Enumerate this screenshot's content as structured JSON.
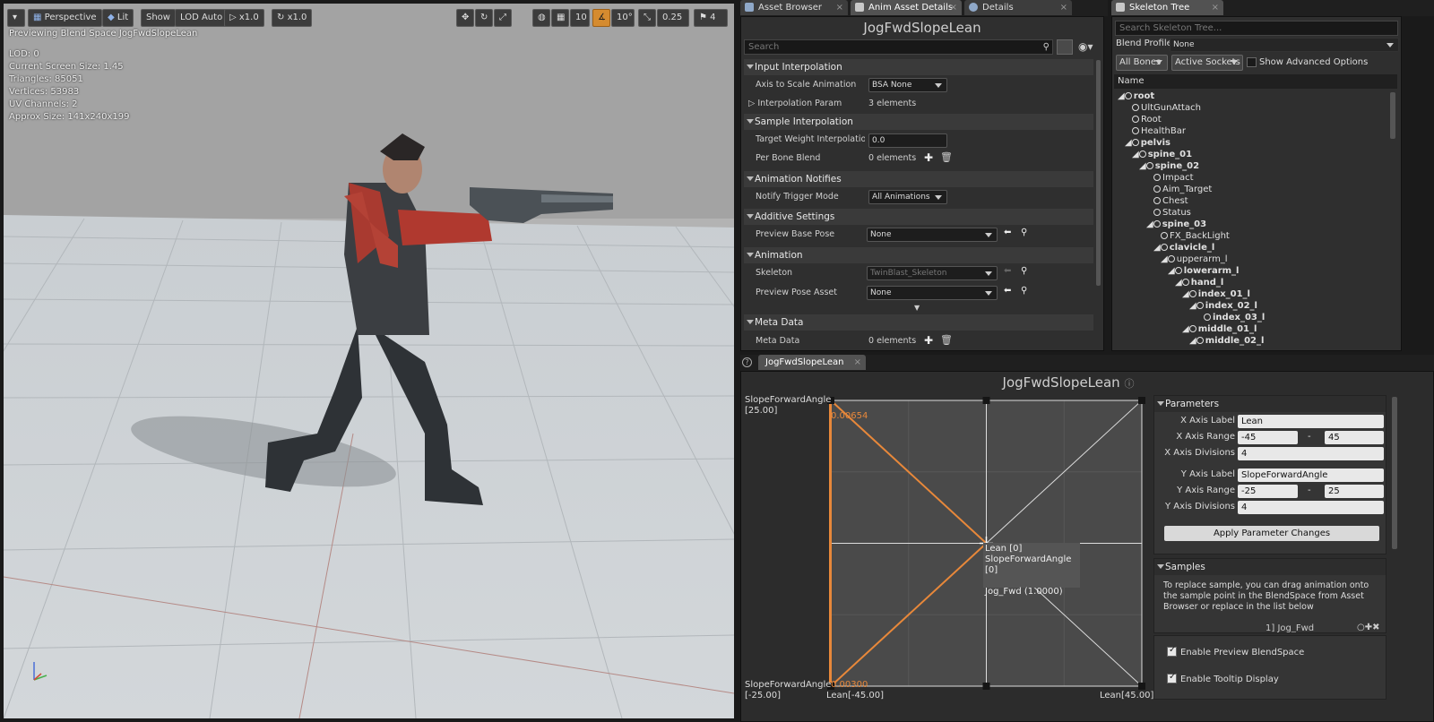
{
  "viewport": {
    "toolbar": {
      "perspective": "Perspective",
      "lit": "Lit",
      "show": "Show",
      "lod": "LOD Auto",
      "speed1": "x1.0",
      "speed2": "x1.0",
      "grid_snap": "10",
      "rot_snap": "10°",
      "scale_snap": "0.25",
      "camera_speed": "4"
    },
    "preview_text": "Previewing Blend Space JogFwdSlopeLean",
    "stats": [
      "LOD: 0",
      "Current Screen Size: 1.45",
      "Triangles: 85051",
      "Vertices: 53983",
      "UV Channels: 2",
      "Approx Size: 141x240x199"
    ]
  },
  "details_panel": {
    "tabs": [
      "Asset Browser",
      "Anim Asset Details",
      "Details"
    ],
    "title": "JogFwdSlopeLean",
    "search_placeholder": "Search",
    "categories": [
      {
        "name": "Input Interpolation",
        "props": [
          {
            "label": "Axis to Scale Animation",
            "value": "BSA None"
          },
          {
            "label": "Interpolation Param",
            "value": "3 elements"
          }
        ]
      },
      {
        "name": "Sample Interpolation",
        "props": [
          {
            "label": "Target Weight Interpolation Sp",
            "value": "0.0"
          },
          {
            "label": "Per Bone Blend",
            "value": "0 elements"
          }
        ]
      },
      {
        "name": "Animation Notifies",
        "props": [
          {
            "label": "Notify Trigger Mode",
            "value": "All Animations"
          }
        ]
      },
      {
        "name": "Additive Settings",
        "props": [
          {
            "label": "Preview Base Pose",
            "value": "None"
          }
        ]
      },
      {
        "name": "Animation",
        "props": [
          {
            "label": "Skeleton",
            "value": "TwinBlast_Skeleton"
          },
          {
            "label": "Preview Pose Asset",
            "value": "None"
          }
        ]
      },
      {
        "name": "Meta Data",
        "props": [
          {
            "label": "Meta Data",
            "value": "0 elements"
          }
        ]
      }
    ]
  },
  "skeleton_tree": {
    "tab": "Skeleton Tree",
    "search_placeholder": "Search Skeleton Tree...",
    "blend_profile_label": "Blend Profile:",
    "blend_profile_value": "None",
    "all_bones": "All Bones",
    "active_sockets": "Active Sockets",
    "show_advanced": "Show Advanced Options",
    "column": "Name",
    "items": [
      "root",
      "UltGunAttach",
      "Root",
      "HealthBar",
      "pelvis",
      "spine_01",
      "spine_02",
      "Impact",
      "Aim_Target",
      "Chest",
      "Status",
      "spine_03",
      "FX_BackLight",
      "clavicle_l",
      "upperarm_l",
      "lowerarm_l",
      "hand_l",
      "index_01_l",
      "index_02_l",
      "index_03_l",
      "middle_01_l",
      "middle_02_l"
    ]
  },
  "blendspace": {
    "tab": "JogFwdSlopeLean",
    "title": "JogFwdSlopeLean",
    "y_axis_top": "SlopeForwardAngle",
    "y_max_label": "[25.00]",
    "y_axis_bottom": "SlopeForwardAngle",
    "y_min_label": "[-25.00]",
    "x_min_label": "Lean[-45.00]",
    "x_max_label": "Lean[45.00]",
    "weight_top": "0.00654",
    "weight_bottom": "0.00300",
    "tooltip": {
      "line1": "Lean [0]",
      "line2": "SlopeForwardAngle [0]",
      "line3": "Jog_Fwd (1.0000)"
    }
  },
  "parameters": {
    "header": "Parameters",
    "x_axis_label_label": "X Axis Label",
    "x_axis_label_value": "Lean",
    "x_range_label": "X Axis Range",
    "x_range_min": "-45",
    "x_range_max": "45",
    "x_divisions_label": "X Axis Divisions",
    "x_divisions": "4",
    "y_axis_label_label": "Y Axis Label",
    "y_axis_label_value": "SlopeForwardAngle",
    "y_range_label": "Y Axis Range",
    "y_range_min": "-25",
    "y_range_max": "25",
    "y_divisions_label": "Y Axis Divisions",
    "y_divisions": "4",
    "range_sep": "-",
    "apply_button": "Apply Parameter Changes"
  },
  "samples": {
    "header": "Samples",
    "description": "To replace sample, you can drag animation onto the sample point in the BlendSpace from Asset Browser or replace in the list below",
    "first_sample": "1] Jog_Fwd"
  },
  "options": {
    "enable_preview": "Enable Preview BlendSpace",
    "enable_tooltip": "Enable Tooltip Display"
  },
  "colors": {
    "accent_orange": "#e8883a",
    "highlight_orange": "#d58b2f"
  }
}
